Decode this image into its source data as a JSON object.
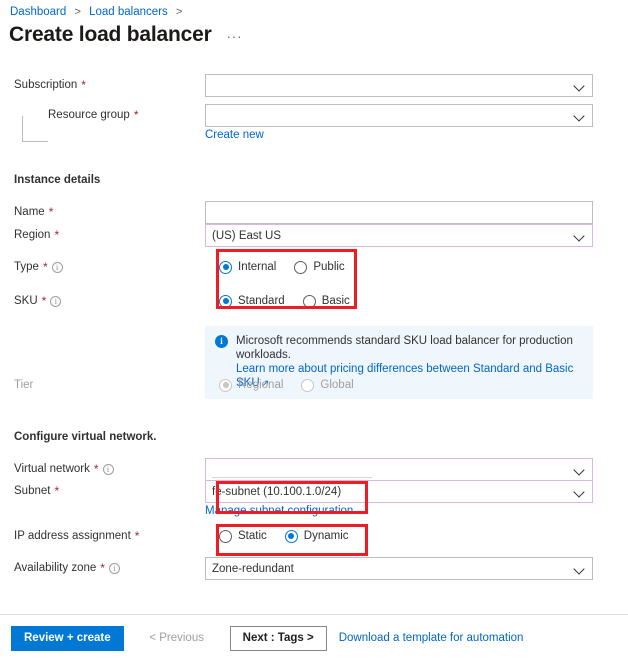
{
  "breadcrumb": {
    "items": [
      "Dashboard",
      "Load balancers"
    ],
    "separator": ">"
  },
  "header": {
    "title": "Create load balancer",
    "more_label": "···"
  },
  "clipped_top_text": "-",
  "basics": {
    "subscription": {
      "label": "Subscription",
      "value": "",
      "required": true
    },
    "resource_group": {
      "label": "Resource group",
      "value": "",
      "required": true,
      "create_new_link": "Create new"
    }
  },
  "instance_details": {
    "heading": "Instance details",
    "name": {
      "label": "Name",
      "value": "",
      "required": true
    },
    "region": {
      "label": "Region",
      "value": "(US) East US",
      "required": true
    },
    "type": {
      "label": "Type",
      "required": true,
      "options": [
        "Internal",
        "Public"
      ],
      "selected": "Internal"
    },
    "sku": {
      "label": "SKU",
      "required": true,
      "options": [
        "Standard",
        "Basic"
      ],
      "selected": "Standard"
    },
    "banner": {
      "text": "Microsoft recommends standard SKU load balancer for production workloads.",
      "link": "Learn more about pricing differences between Standard and Basic SKU",
      "external_glyph": "↗"
    },
    "tier": {
      "label": "Tier",
      "required": false,
      "disabled": true,
      "options": [
        "Regional",
        "Global"
      ],
      "selected": "Regional"
    }
  },
  "virtual_network": {
    "heading": "Configure virtual network.",
    "vnet": {
      "label": "Virtual network",
      "value": "",
      "required": true
    },
    "subnet": {
      "label": "Subnet",
      "value": "fe-subnet (10.100.1.0/24)",
      "required": true,
      "manage_link": "Manage subnet configuration"
    },
    "ip_assignment": {
      "label": "IP address assignment",
      "required": true,
      "options": [
        "Static",
        "Dynamic"
      ],
      "selected": "Dynamic"
    },
    "availability_zone": {
      "label": "Availability zone",
      "value": "Zone-redundant",
      "required": true
    }
  },
  "footer": {
    "review_create": "Review + create",
    "previous": "< Previous",
    "next": "Next : Tags >",
    "download_link": "Download a template for automation"
  },
  "colors": {
    "accent": "#0078d4",
    "link": "#0066cc",
    "required_asterisk": "#a4262c",
    "annotation": "#ee1c25",
    "banner_bg": "#eff6fc",
    "violet_border": "#d9b8dd"
  }
}
